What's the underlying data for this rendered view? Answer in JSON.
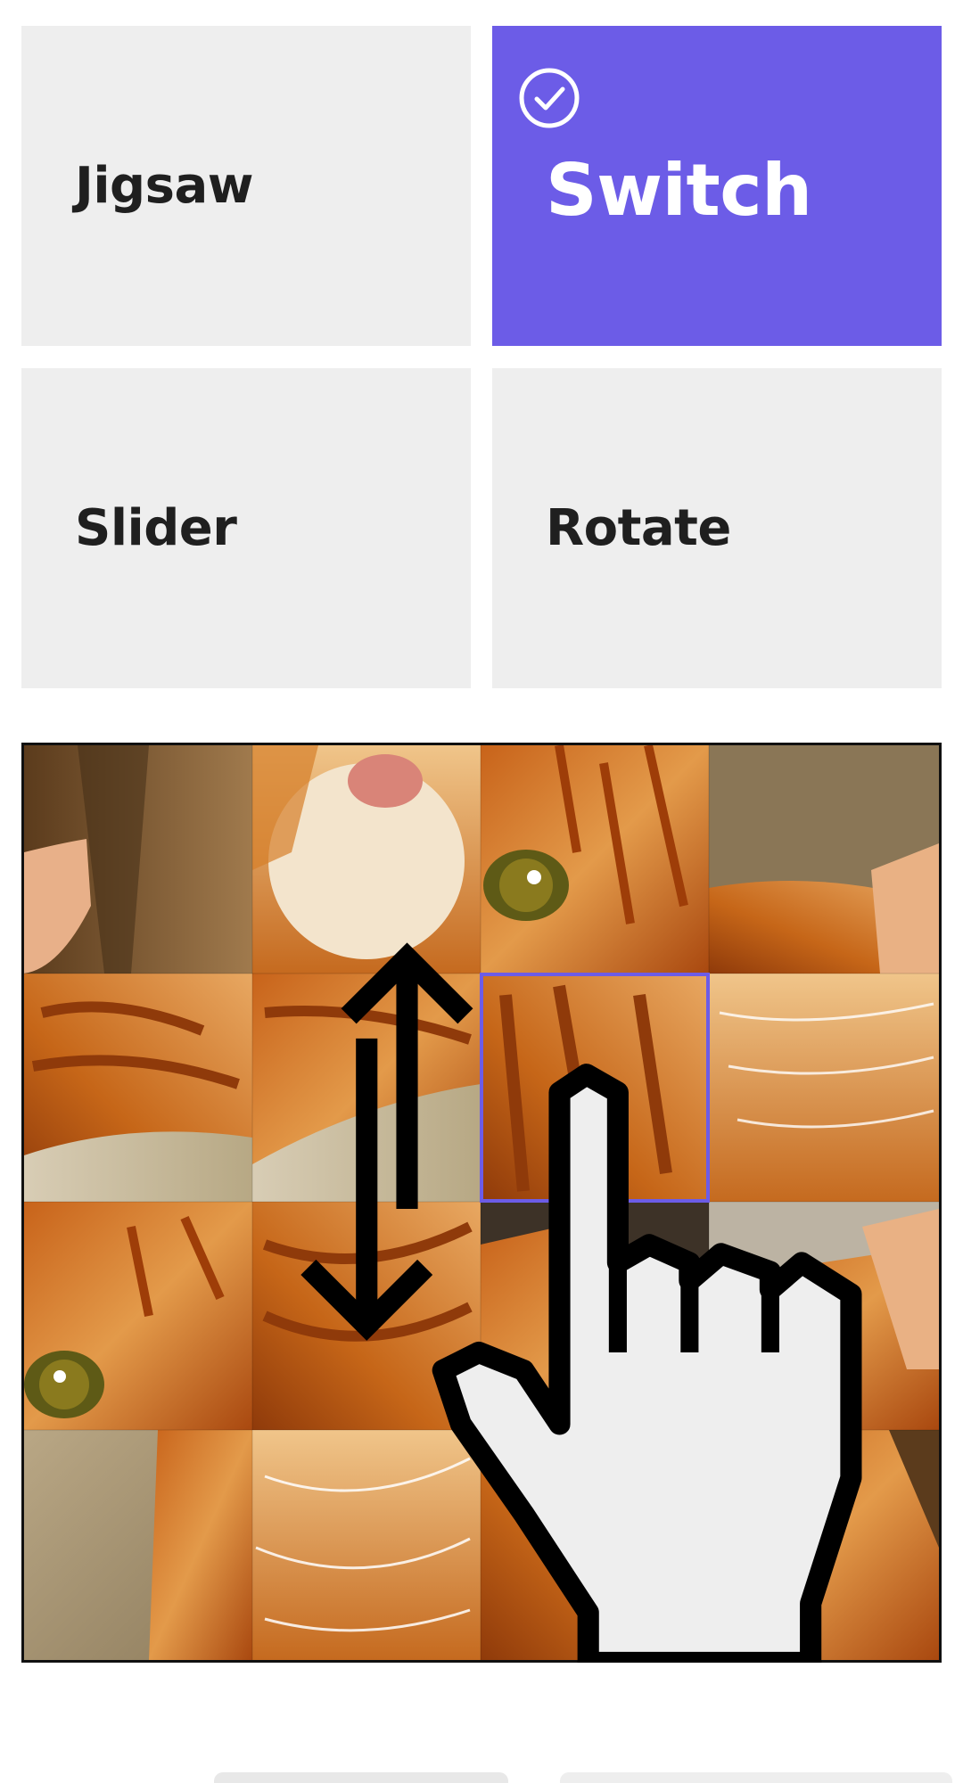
{
  "modes": [
    {
      "id": "jigsaw",
      "label": "Jigsaw",
      "selected": false
    },
    {
      "id": "switch",
      "label": "Switch",
      "selected": true
    },
    {
      "id": "slider",
      "label": "Slider",
      "selected": false
    },
    {
      "id": "rotate",
      "label": "Rotate",
      "selected": false
    }
  ],
  "icons": {
    "selected_check": "check-circle-icon",
    "tutorial_hand": "pointing-hand-icon",
    "swap_arrows": "up-down-arrows-icon"
  },
  "colors": {
    "accent": "#6c5ce7",
    "card_bg": "#eeeeee",
    "label_text": "#1f1f1f",
    "selected_text": "#ffffff",
    "tile_highlight": "#6c5ce7"
  },
  "puzzle": {
    "grid_rows": 4,
    "grid_cols": 4,
    "image_subject": "orange tabby cat",
    "highlighted_tile": {
      "row": 1,
      "col": 2
    }
  }
}
